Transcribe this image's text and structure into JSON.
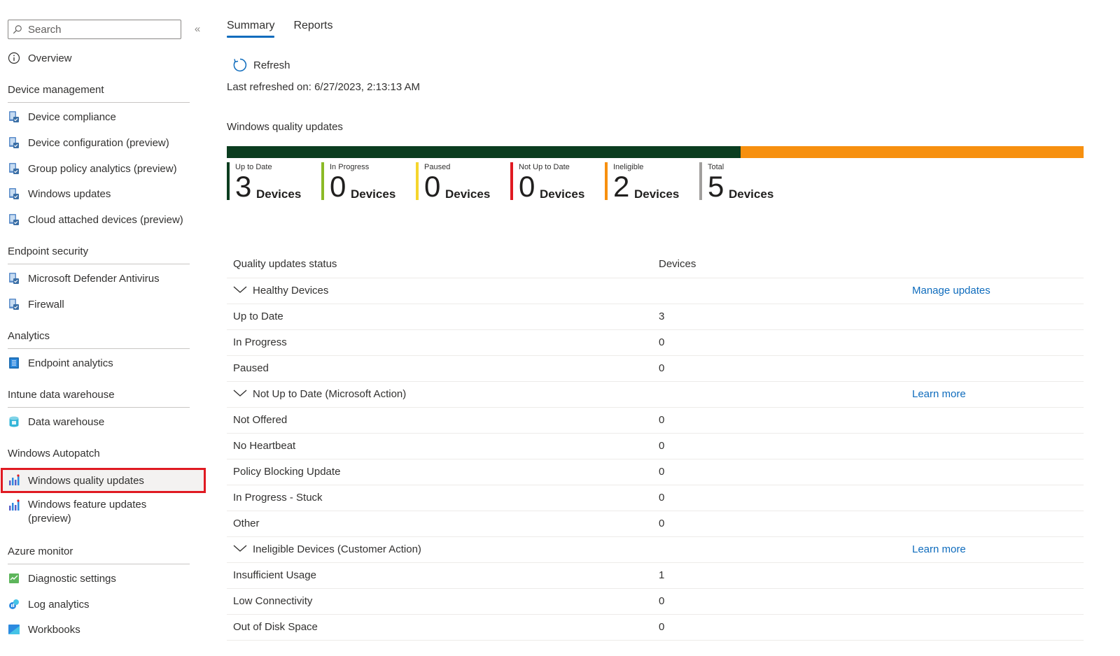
{
  "search": {
    "placeholder": "Search"
  },
  "collapse_label": "«",
  "nav": {
    "overview": "Overview",
    "groups": {
      "device_management": "Device management",
      "endpoint_security": "Endpoint security",
      "analytics": "Analytics",
      "intune_data_warehouse": "Intune data warehouse",
      "windows_autopatch": "Windows Autopatch",
      "azure_monitor": "Azure monitor"
    },
    "items": {
      "device_compliance": "Device compliance",
      "device_configuration": "Device configuration (preview)",
      "group_policy_analytics": "Group policy analytics (preview)",
      "windows_updates": "Windows updates",
      "cloud_attached_devices": "Cloud attached devices (preview)",
      "defender_antivirus": "Microsoft Defender Antivirus",
      "firewall": "Firewall",
      "endpoint_analytics": "Endpoint analytics",
      "data_warehouse": "Data warehouse",
      "windows_quality_updates": "Windows quality updates",
      "windows_feature_updates": "Windows feature updates (preview)",
      "diagnostic_settings": "Diagnostic settings",
      "log_analytics": "Log analytics",
      "workbooks": "Workbooks"
    },
    "selected": "windows_quality_updates"
  },
  "tabs": [
    {
      "label": "Summary",
      "active": true
    },
    {
      "label": "Reports",
      "active": false
    }
  ],
  "toolbar": {
    "refresh_label": "Refresh",
    "last_refreshed": "Last refreshed on: 6/27/2023, 2:13:13 AM"
  },
  "summary": {
    "title": "Windows quality updates",
    "bar": [
      {
        "status": "Up to Date",
        "count": 3,
        "color": "#0b3d1f"
      },
      {
        "status": "Ineligible",
        "count": 2,
        "color": "#f7900f"
      }
    ],
    "stats": [
      {
        "label": "Up to Date",
        "value": "3",
        "unit": "Devices",
        "color": "#0b3d1f"
      },
      {
        "label": "In Progress",
        "value": "0",
        "unit": "Devices",
        "color": "#8cba27"
      },
      {
        "label": "Paused",
        "value": "0",
        "unit": "Devices",
        "color": "#f5d52d"
      },
      {
        "label": "Not Up to Date",
        "value": "0",
        "unit": "Devices",
        "color": "#e01a22"
      },
      {
        "label": "Ineligible",
        "value": "2",
        "unit": "Devices",
        "color": "#f7900f"
      },
      {
        "label": "Total",
        "value": "5",
        "unit": "Devices",
        "color": "#a19f9d"
      }
    ]
  },
  "table": {
    "headers": {
      "status": "Quality updates status",
      "devices": "Devices"
    },
    "groups": [
      {
        "name": "Healthy Devices",
        "link": "Manage updates",
        "rows": [
          {
            "status": "Up to Date",
            "devices": "3"
          },
          {
            "status": "In Progress",
            "devices": "0"
          },
          {
            "status": "Paused",
            "devices": "0"
          }
        ]
      },
      {
        "name": "Not Up to Date (Microsoft Action)",
        "link": "Learn more",
        "rows": [
          {
            "status": "Not Offered",
            "devices": "0"
          },
          {
            "status": "No Heartbeat",
            "devices": "0"
          },
          {
            "status": "Policy Blocking Update",
            "devices": "0"
          },
          {
            "status": "In Progress - Stuck",
            "devices": "0"
          },
          {
            "status": "Other",
            "devices": "0"
          }
        ]
      },
      {
        "name": "Ineligible Devices (Customer Action)",
        "link": "Learn more",
        "rows": [
          {
            "status": "Insufficient Usage",
            "devices": "1"
          },
          {
            "status": "Low Connectivity",
            "devices": "0"
          },
          {
            "status": "Out of Disk Space",
            "devices": "0"
          }
        ]
      }
    ]
  }
}
